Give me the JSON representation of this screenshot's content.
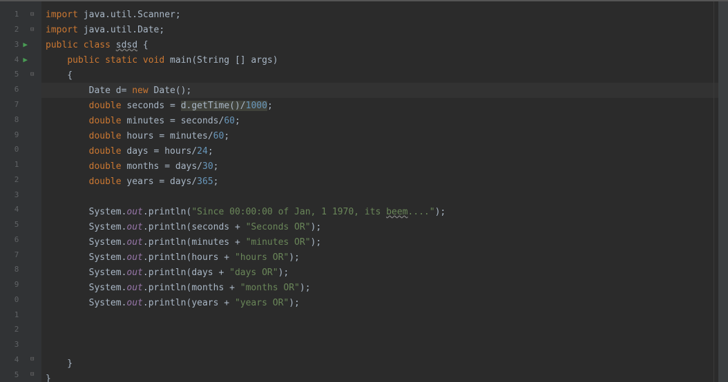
{
  "lines": [
    {
      "n": "1",
      "fold": "⊟",
      "content": [
        {
          "t": "kw",
          "v": "import "
        },
        {
          "t": "",
          "v": "java.util.Scanner;"
        }
      ]
    },
    {
      "n": "2",
      "fold": "⊟",
      "content": [
        {
          "t": "kw",
          "v": "import "
        },
        {
          "t": "",
          "v": "java.util.Date;"
        }
      ]
    },
    {
      "n": "3",
      "run": "▶",
      "content": [
        {
          "t": "kw",
          "v": "public class "
        },
        {
          "t": "warn",
          "v": "sdsd"
        },
        {
          "t": "",
          "v": " {"
        }
      ]
    },
    {
      "n": "4",
      "run": "▶",
      "content": [
        {
          "t": "",
          "v": "    "
        },
        {
          "t": "kw",
          "v": "public static void "
        },
        {
          "t": "",
          "v": "main(String [] args)"
        }
      ]
    },
    {
      "n": "5",
      "fold": "⊟",
      "content": [
        {
          "t": "",
          "v": "    {"
        }
      ]
    },
    {
      "n": "6",
      "bulb": "💡",
      "highlight": true,
      "content": [
        {
          "t": "",
          "v": "        Date d= "
        },
        {
          "t": "kw",
          "v": "new "
        },
        {
          "t": "",
          "v": "Date();"
        }
      ]
    },
    {
      "n": "7",
      "content": [
        {
          "t": "",
          "v": "        "
        },
        {
          "t": "kw",
          "v": "double "
        },
        {
          "t": "",
          "v": "seconds = "
        },
        {
          "t": "hl-call",
          "v": "d.getTime()/"
        },
        {
          "t": "hl-call num",
          "v": "1000"
        },
        {
          "t": "",
          "v": ";"
        }
      ]
    },
    {
      "n": "8",
      "content": [
        {
          "t": "",
          "v": "        "
        },
        {
          "t": "kw",
          "v": "double "
        },
        {
          "t": "",
          "v": "minutes = seconds/"
        },
        {
          "t": "num",
          "v": "60"
        },
        {
          "t": "",
          "v": ";"
        }
      ]
    },
    {
      "n": "9",
      "content": [
        {
          "t": "",
          "v": "        "
        },
        {
          "t": "kw",
          "v": "double "
        },
        {
          "t": "",
          "v": "hours = minutes/"
        },
        {
          "t": "num",
          "v": "60"
        },
        {
          "t": "",
          "v": ";"
        }
      ]
    },
    {
      "n": "0",
      "content": [
        {
          "t": "",
          "v": "        "
        },
        {
          "t": "kw",
          "v": "double "
        },
        {
          "t": "",
          "v": "days = hours/"
        },
        {
          "t": "num",
          "v": "24"
        },
        {
          "t": "",
          "v": ";"
        }
      ]
    },
    {
      "n": "1",
      "content": [
        {
          "t": "",
          "v": "        "
        },
        {
          "t": "kw",
          "v": "double "
        },
        {
          "t": "",
          "v": "months = days/"
        },
        {
          "t": "num",
          "v": "30"
        },
        {
          "t": "",
          "v": ";"
        }
      ]
    },
    {
      "n": "2",
      "content": [
        {
          "t": "",
          "v": "        "
        },
        {
          "t": "kw",
          "v": "double "
        },
        {
          "t": "",
          "v": "years = days/"
        },
        {
          "t": "num",
          "v": "365"
        },
        {
          "t": "",
          "v": ";"
        }
      ]
    },
    {
      "n": "3",
      "content": []
    },
    {
      "n": "4",
      "content": [
        {
          "t": "",
          "v": "        System."
        },
        {
          "t": "field",
          "v": "out"
        },
        {
          "t": "",
          "v": ".println("
        },
        {
          "t": "str",
          "v": "\"Since 00:00:00 of Jan, 1 1970, its "
        },
        {
          "t": "str warn",
          "v": "beem"
        },
        {
          "t": "str",
          "v": "....\""
        },
        {
          "t": "",
          "v": ");"
        }
      ]
    },
    {
      "n": "5",
      "content": [
        {
          "t": "",
          "v": "        System."
        },
        {
          "t": "field",
          "v": "out"
        },
        {
          "t": "",
          "v": ".println(seconds + "
        },
        {
          "t": "str",
          "v": "\"Seconds OR\""
        },
        {
          "t": "",
          "v": ");"
        }
      ]
    },
    {
      "n": "6",
      "content": [
        {
          "t": "",
          "v": "        System."
        },
        {
          "t": "field",
          "v": "out"
        },
        {
          "t": "",
          "v": ".println(minutes + "
        },
        {
          "t": "str",
          "v": "\"minutes OR\""
        },
        {
          "t": "",
          "v": ");"
        }
      ]
    },
    {
      "n": "7",
      "content": [
        {
          "t": "",
          "v": "        System."
        },
        {
          "t": "field",
          "v": "out"
        },
        {
          "t": "",
          "v": ".println(hours + "
        },
        {
          "t": "str",
          "v": "\"hours OR\""
        },
        {
          "t": "",
          "v": ");"
        }
      ]
    },
    {
      "n": "8",
      "content": [
        {
          "t": "",
          "v": "        System."
        },
        {
          "t": "field",
          "v": "out"
        },
        {
          "t": "",
          "v": ".println(days + "
        },
        {
          "t": "str",
          "v": "\"days OR\""
        },
        {
          "t": "",
          "v": ");"
        }
      ]
    },
    {
      "n": "9",
      "content": [
        {
          "t": "",
          "v": "        System."
        },
        {
          "t": "field",
          "v": "out"
        },
        {
          "t": "",
          "v": ".println(months + "
        },
        {
          "t": "str",
          "v": "\"months OR\""
        },
        {
          "t": "",
          "v": ");"
        }
      ]
    },
    {
      "n": "0",
      "content": [
        {
          "t": "",
          "v": "        System."
        },
        {
          "t": "field",
          "v": "out"
        },
        {
          "t": "",
          "v": ".println(years + "
        },
        {
          "t": "str",
          "v": "\"years OR\""
        },
        {
          "t": "",
          "v": ");"
        }
      ]
    },
    {
      "n": "1",
      "content": []
    },
    {
      "n": "2",
      "content": []
    },
    {
      "n": "3",
      "content": []
    },
    {
      "n": "4",
      "fold": "⊟",
      "content": [
        {
          "t": "",
          "v": "    }"
        }
      ]
    },
    {
      "n": "5",
      "fold": "⊟",
      "content": [
        {
          "t": "",
          "v": "}"
        }
      ]
    }
  ]
}
